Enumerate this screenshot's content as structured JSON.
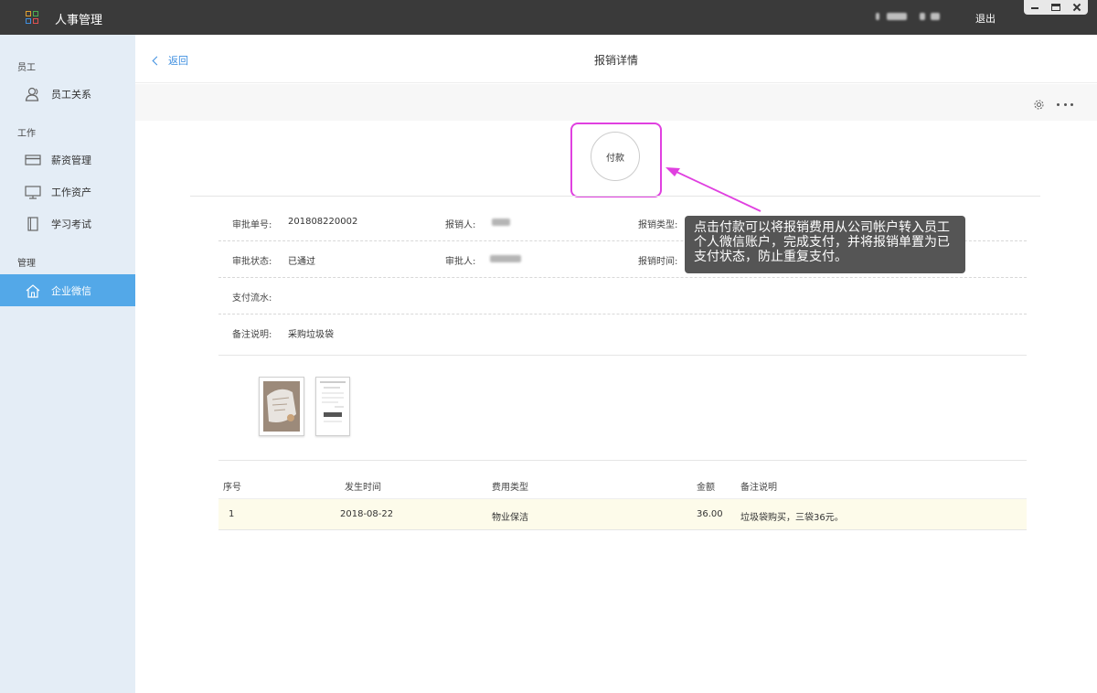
{
  "app": {
    "title": "人事管理",
    "logout_label": "退出"
  },
  "window_controls": [
    "minimize-icon",
    "maximize-icon",
    "close-icon"
  ],
  "sidebar": {
    "sections": [
      {
        "label": "员工",
        "items": [
          {
            "label": "员工关系",
            "icon": "user-relations-icon"
          }
        ]
      },
      {
        "label": "工作",
        "items": [
          {
            "label": "薪资管理",
            "icon": "card-icon"
          },
          {
            "label": "工作资产",
            "icon": "monitor-icon"
          },
          {
            "label": "学习考试",
            "icon": "book-icon"
          }
        ]
      },
      {
        "label": "管理",
        "items": [
          {
            "label": "企业微信",
            "icon": "home-icon",
            "active": true
          }
        ]
      }
    ]
  },
  "header": {
    "back_label": "返回",
    "title": "报销详情"
  },
  "toolbar": {
    "icons": [
      "gear-icon",
      "more-icon"
    ]
  },
  "pay_button": {
    "label": "付款"
  },
  "details": {
    "approval_no_label": "审批单号:",
    "approval_no": "201808220002",
    "applicant_label": "报销人:",
    "type_label": "报销类型:",
    "status_label": "审批状态:",
    "status": "已通过",
    "approver_label": "审批人:",
    "time_label": "报销时间:",
    "payment_serial_label": "支付流水:",
    "remark_label": "备注说明:",
    "remark": "采购垃圾袋"
  },
  "table": {
    "headers": [
      "序号",
      "发生时间",
      "费用类型",
      "金额",
      "备注说明"
    ],
    "rows": [
      {
        "index": "1",
        "date": "2018-08-22",
        "type": "物业保洁",
        "amount": "36.00",
        "note": "垃圾袋购买，三袋36元。"
      }
    ]
  },
  "annotation": {
    "text": "点击付款可以将报销费用从公司帐户转入员工个人微信账户，完成支付，并将报销单置为已支付状态，防止重复支付。",
    "color": "#e040e0"
  },
  "colors": {
    "accent": "#53a8e8",
    "link": "#3f8fe0",
    "titlebar": "#3a3a3a",
    "sidebar_bg": "#e4edf6",
    "row_highlight": "#fdfbea"
  }
}
